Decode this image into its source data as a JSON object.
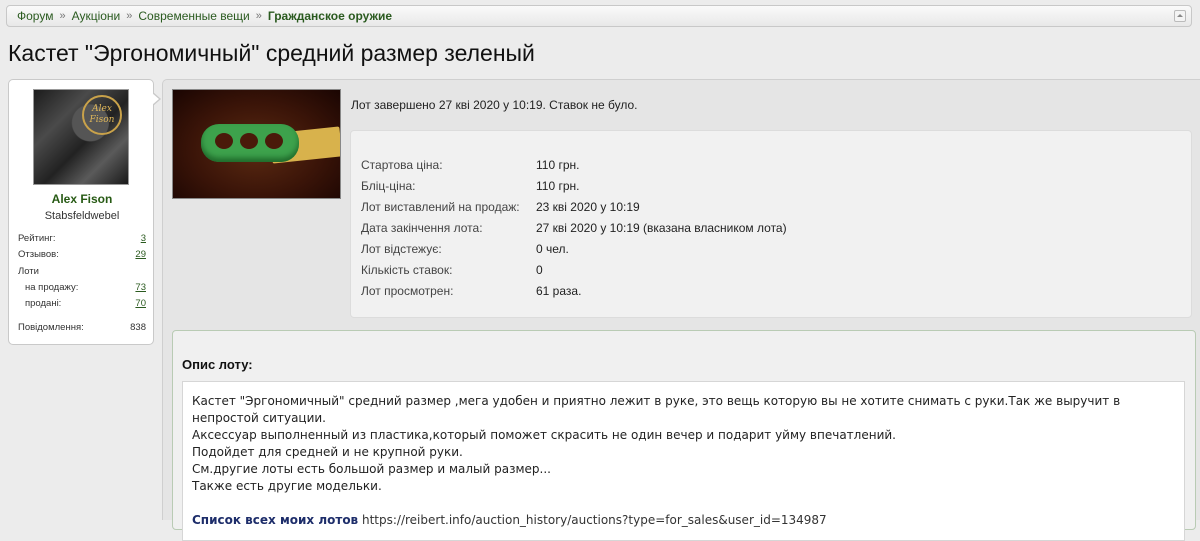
{
  "breadcrumb": {
    "items": [
      "Форум",
      "Аукціони",
      "Современные вещи"
    ],
    "current": "Гражданское оружие"
  },
  "title": "Кастет \"Эргономичный\" средний размер зеленый",
  "user": {
    "avatar_text": "Alex Fison",
    "name": "Alex Fison",
    "rank": "Stabsfeldwebel",
    "stats": {
      "rating_label": "Рейтинг:",
      "rating": "3",
      "reviews_label": "Отзывов:",
      "reviews": "29",
      "lots_label": "Лоти",
      "for_sale_label": "на продажу:",
      "for_sale": "73",
      "sold_label": "продані:",
      "sold": "70",
      "messages_label": "Повідомлення:",
      "messages": "838"
    }
  },
  "lot": {
    "status": "Лот завершено 27 кві 2020 у 10:19. Ставок не було.",
    "rows": [
      {
        "label": "Стартова ціна:",
        "value": "110 грн."
      },
      {
        "label": "Бліц-ціна:",
        "value": "110 грн."
      },
      {
        "label": "Лот виставлений на продаж:",
        "value": "23 кві 2020 у 10:19"
      },
      {
        "label": "Дата закінчення лота:",
        "value": "27 кві 2020 у 10:19 (вказана власником лота)"
      },
      {
        "label": "Лот відстежує:",
        "value": "0 чел."
      },
      {
        "label": "Кількість ставок:",
        "value": "0"
      },
      {
        "label": "Лот просмотрен:",
        "value": "61 раза."
      }
    ]
  },
  "description": {
    "heading": "Опис лоту:",
    "lines": [
      "Кастет \"Эргономичный\" средний размер ,мега удобен и приятно лежит в руке, это вещь которую вы не хотите снимать с руки.Так же выручит в непростой ситуации.",
      "Аксессуар выполненный из пластика,который поможет скрасить не один вечер и подарит уйму впечатлений.",
      "Подойдет для средней и не крупной руки.",
      "См.другие лоты есть большой размер и малый размер...",
      "Также есть другие модельки."
    ],
    "seller_label": "Список всех моих лотов",
    "seller_link": "https://reibert.info/auction_history/auctions?type=for_sales&user_id=134987"
  }
}
